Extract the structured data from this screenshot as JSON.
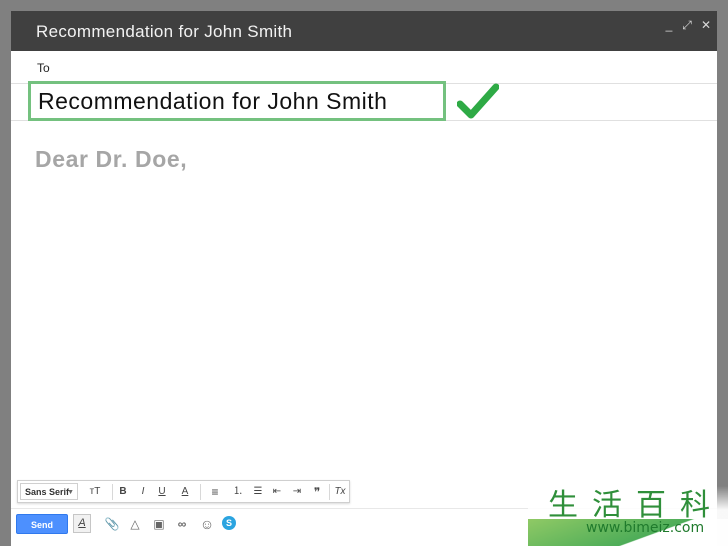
{
  "window": {
    "title": "Recommendation for John Smith",
    "controls": {
      "minimize": "_",
      "expand": "⤢",
      "close": "✕"
    }
  },
  "compose": {
    "to_label": "To",
    "subject": "Recommendation for John Smith",
    "body": "Dear Dr. Doe,",
    "check_icon": "checkmark-icon",
    "check_color": "#2eaa45",
    "highlight_color": "#74c17f"
  },
  "toolbar": {
    "font": "Sans Serif",
    "size_icon": "тT",
    "bold": "B",
    "italic": "I",
    "underline": "U",
    "text_color": "A",
    "align": "≡",
    "numbered_list": "⒈",
    "bulleted_list": "☰",
    "indent_less": "⇤",
    "indent_more": "⇥",
    "quote": "❞",
    "remove_format": "Tx"
  },
  "actions": {
    "send_label": "Send",
    "formatting_label": "A",
    "attach": "📎",
    "drive": "△",
    "photo": "▣",
    "link": "∞",
    "emoji": "☺",
    "skype": "S"
  },
  "watermark": {
    "chars": "生活百科",
    "url": "www.bimeiz.com"
  }
}
